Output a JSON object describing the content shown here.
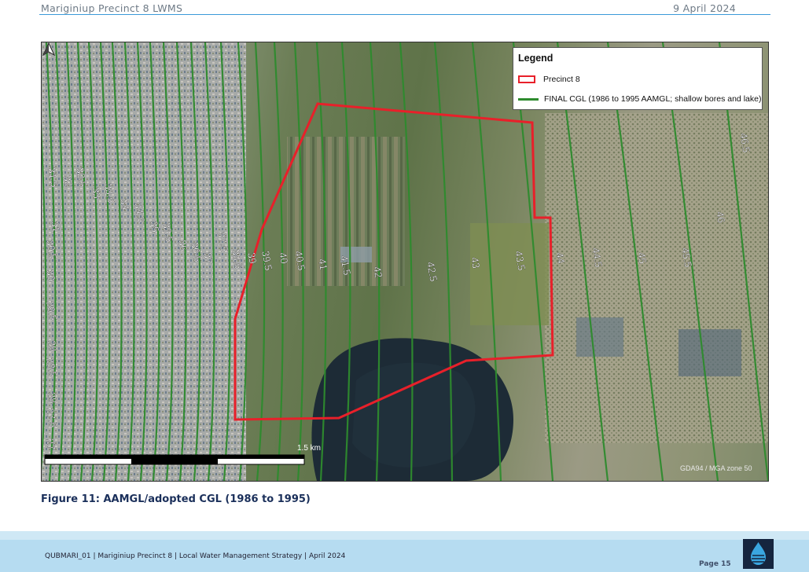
{
  "header": {
    "title": "Mariginiup Precinct 8 LWMS",
    "date": "9 April 2024"
  },
  "map": {
    "legend": {
      "title": "Legend",
      "items": [
        {
          "label": "Precinct 8",
          "color": "#e8202a",
          "symbol": "outline-box"
        },
        {
          "label": "FINAL CGL (1986 to 1995 AAMGL; shallow bores and lake)",
          "color": "#2e8b2e",
          "symbol": "line"
        }
      ]
    },
    "contour_labels": [
      "31.5",
      "32",
      "32.5",
      "33",
      "33.5",
      "34",
      "34.5",
      "35",
      "35.5",
      "36",
      "36.5",
      "37",
      "37.5",
      "38.5",
      "39",
      "39.5",
      "40",
      "40.5",
      "41",
      "41.5",
      "42",
      "42.5",
      "43",
      "43.5",
      "44",
      "44.5",
      "45",
      "45.5",
      "46",
      "46.5",
      "31",
      "30.5",
      "30",
      "29.5",
      "29",
      "28.5",
      "28",
      "27.5",
      "27"
    ],
    "scale_label": "1.5 km",
    "crs_label": "GDA94 / MGA zone 50",
    "north_icon": "north-arrow-icon"
  },
  "caption": "Figure 11: AAMGL/adopted CGL (1986 to 1995)",
  "footer": {
    "text": "QUBMARI_01 | Mariginiup Precinct 8 | Local Water Management Strategy | April 2024",
    "page": "Page 15",
    "logo_icon": "water-drop-logo-icon"
  }
}
